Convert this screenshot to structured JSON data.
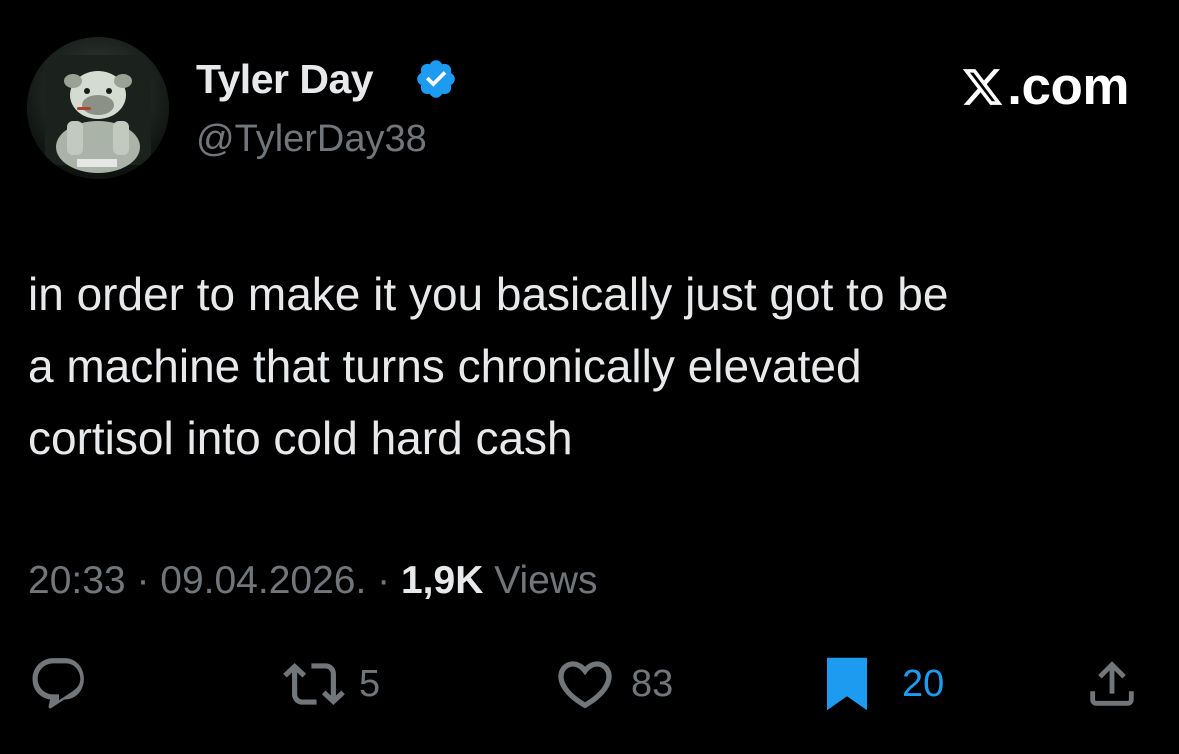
{
  "author": {
    "display_name": "Tyler Day",
    "handle": "@TylerDay38",
    "verified": true
  },
  "brand": {
    "suffix": ".com"
  },
  "tweet": {
    "text": "in order to make it you basically just got to be\na machine that turns chronically elevated\ncortisol into cold hard cash"
  },
  "meta": {
    "time": "20:33",
    "separator": " · ",
    "date": "09.04.2026.",
    "views_count": "1,9K",
    "views_label": " Views"
  },
  "actions": {
    "reply": {
      "icon": "reply-icon"
    },
    "repost": {
      "icon": "repost-icon",
      "count": "5"
    },
    "like": {
      "icon": "heart-icon",
      "count": "83"
    },
    "bookmark": {
      "icon": "bookmark-icon",
      "count": "20",
      "active": true
    },
    "share": {
      "icon": "share-icon"
    }
  },
  "colors": {
    "background": "#000000",
    "text": "#e7e9ea",
    "muted": "#71767b",
    "accent": "#1d9bf0"
  }
}
